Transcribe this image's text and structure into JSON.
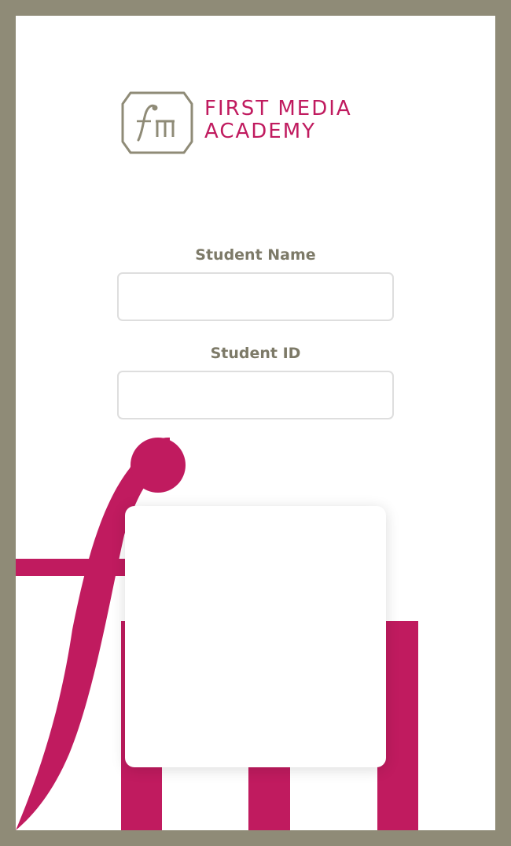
{
  "brand": {
    "name_line1": "First Media",
    "name_line2": "Academy",
    "colors": {
      "accent": "#c01b5f",
      "frame": "#8f8b77",
      "label": "#7d7a68"
    }
  },
  "form": {
    "student_name": {
      "label": "Student Name",
      "value": "",
      "placeholder": ""
    },
    "student_id": {
      "label": "Student ID",
      "value": "",
      "placeholder": ""
    }
  },
  "decorations": {
    "logo_icon": "fm-logo-icon",
    "background_icon": "fm-monogram-icon"
  }
}
